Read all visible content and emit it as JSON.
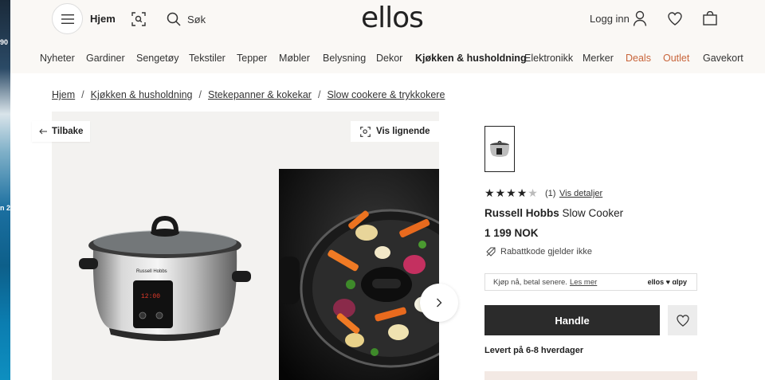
{
  "background_window": {
    "texts": [
      "90",
      "n 2"
    ]
  },
  "header": {
    "home_label": "Hjem",
    "search_label": "Søk",
    "logo": "ellos",
    "login_label": "Logg inn"
  },
  "categories": [
    "Nyheter",
    "Gardiner",
    "Sengetøy",
    "Tekstiler",
    "Tepper",
    "Møbler",
    "Belysning",
    "Dekor",
    "Kjøkken & husholdning",
    "Elektronikk",
    "Merker",
    "Deals",
    "Outlet",
    "Gavekort"
  ],
  "active_category": "Kjøkken & husholdning",
  "breadcrumb": [
    "Hjem",
    "Kjøkken & husholdning",
    "Stekepanner & kokekar",
    "Slow cookere & trykkokere"
  ],
  "breadcrumb_separator": "/",
  "gallery": {
    "back_label": "Tilbake",
    "similar_label": "Vis lignende",
    "cooker_brand_text": "Russell Hobbs",
    "cooker_display": "12:00"
  },
  "product": {
    "rating": 4,
    "rating_max": 5,
    "rating_count": "(1)",
    "details_link": "Vis detaljer",
    "brand": "Russell Hobbs",
    "name": "Slow Cooker",
    "price": "1 199 NOK",
    "promo_note": "Rabattkode gjelder ikke",
    "installment_text": "Kjøp nå, betal senere.",
    "installment_link": "Les mer",
    "payment_logos": "ellos ♥ ɑlpy",
    "buy_label": "Handle",
    "delivery_text": "Levert på 6-8 hverdager"
  },
  "colors": {
    "header_bg": "#faf8f5",
    "deals": "#c8643a",
    "buy_button": "#2b2b2b",
    "star": "#222222"
  }
}
